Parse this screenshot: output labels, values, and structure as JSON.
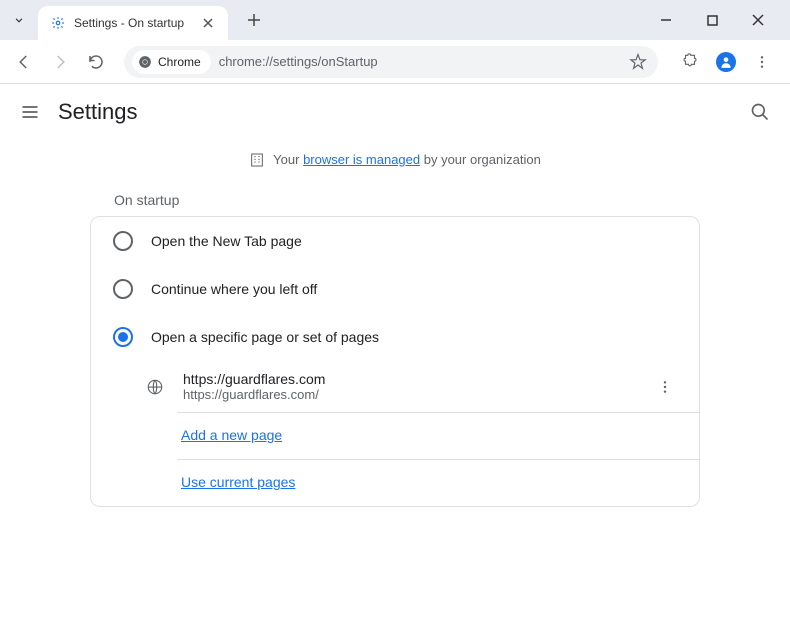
{
  "titlebar": {
    "tab_title": "Settings - On startup"
  },
  "toolbar": {
    "badge_text": "Chrome",
    "url": "chrome://settings/onStartup"
  },
  "settings": {
    "title": "Settings"
  },
  "managed": {
    "prefix": "Your ",
    "link": "browser is managed",
    "suffix": " by your organization"
  },
  "section": {
    "label": "On startup",
    "options": [
      {
        "label": "Open the New Tab page"
      },
      {
        "label": "Continue where you left off"
      },
      {
        "label": "Open a specific page or set of pages"
      }
    ],
    "pages": [
      {
        "title": "https://guardflares.com",
        "url": "https://guardflares.com/"
      }
    ],
    "add_page": "Add a new page",
    "use_current": "Use current pages"
  }
}
